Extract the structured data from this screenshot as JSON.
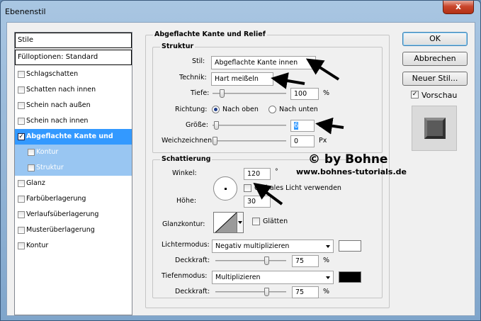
{
  "window": {
    "title": "Ebenenstil",
    "close_glyph": "x"
  },
  "style_list": {
    "header": "Stile",
    "blend_options": "Fülloptionen: Standard",
    "items": [
      {
        "label": "Schlagschatten",
        "checked": false
      },
      {
        "label": "Schatten nach innen",
        "checked": false
      },
      {
        "label": "Schein nach außen",
        "checked": false
      },
      {
        "label": "Schein nach innen",
        "checked": false
      },
      {
        "label": "Abgeflachte Kante und Relief",
        "checked": true,
        "selected": true
      },
      {
        "label": "Kontur",
        "checked": false,
        "sub": true
      },
      {
        "label": "Struktur",
        "checked": false,
        "sub": true
      },
      {
        "label": "Glanz",
        "checked": false
      },
      {
        "label": "Farbüberlagerung",
        "checked": false
      },
      {
        "label": "Verlaufsüberlagerung",
        "checked": false
      },
      {
        "label": "Musterüberlagerung",
        "checked": false
      },
      {
        "label": "Kontur",
        "checked": false
      }
    ]
  },
  "bevel": {
    "title": "Abgeflachte Kante und Relief",
    "structure": {
      "title": "Struktur",
      "style_label": "Stil:",
      "style_value": "Abgeflachte Kante innen",
      "technique_label": "Technik:",
      "technique_value": "Hart meißeln",
      "depth_label": "Tiefe:",
      "depth_value": "100",
      "depth_unit": "%",
      "depth_level": 0.1,
      "direction_label": "Richtung:",
      "direction_up": "Nach oben",
      "direction_down": "Nach unten",
      "size_label": "Größe:",
      "size_value": "6",
      "size_unit": "Px",
      "size_level": 0.02,
      "soften_label": "Weichzeichnen:",
      "soften_value": "0",
      "soften_unit": "Px",
      "soften_level": 0.0
    },
    "shading": {
      "title": "Schattierung",
      "angle_label": "Winkel:",
      "angle_value": "120",
      "angle_unit": "°",
      "global_light_label": "Globales Licht verwenden",
      "altitude_label": "Höhe:",
      "altitude_value": "30",
      "gloss_label": "Glanzkontur:",
      "antialias_label": "Glätten",
      "highlight_mode_label": "Lichtermodus:",
      "highlight_mode_value": "Negativ multiplizieren",
      "highlight_color": "#ffffff",
      "highlight_opacity_label": "Deckkraft:",
      "highlight_opacity_value": "75",
      "highlight_opacity_unit": "%",
      "shadow_mode_label": "Tiefenmodus:",
      "shadow_mode_value": "Multiplizieren",
      "shadow_color": "#000000",
      "shadow_opacity_label": "Deckkraft:",
      "shadow_opacity_value": "75",
      "shadow_opacity_unit": "%"
    }
  },
  "buttons": {
    "ok": "OK",
    "cancel": "Abbrechen",
    "new_style": "Neuer Stil...",
    "preview_label": "Vorschau"
  },
  "watermark": {
    "line1": "© by Bohne",
    "line2": "www.bohnes-tutorials.de"
  },
  "colors": {
    "selection": "#3399ff",
    "sub_selection": "#99c6f2",
    "close": "#c9462c"
  }
}
